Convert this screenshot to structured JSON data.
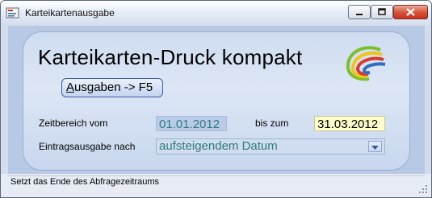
{
  "window": {
    "title": "Karteikartenausgabe"
  },
  "heading": "Karteikarten-Druck kompakt",
  "output_button": {
    "underlined": "A",
    "rest": "usgaben -> F5"
  },
  "date_range": {
    "from_label": "Zeitbereich vom",
    "from_value": "01.01.2012",
    "to_label": "bis zum",
    "to_value": "31.03.2012"
  },
  "entry_order": {
    "label": "Eintragsausgabe nach",
    "selected": "aufsteigendem Datum"
  },
  "status": {
    "text": "Setzt das Ende des Abfragezeitraums"
  },
  "colors": {
    "teal_text": "#2f7d7d",
    "active_field_bg": "#ffffcc",
    "panel_bg": "#d8e3f3"
  }
}
